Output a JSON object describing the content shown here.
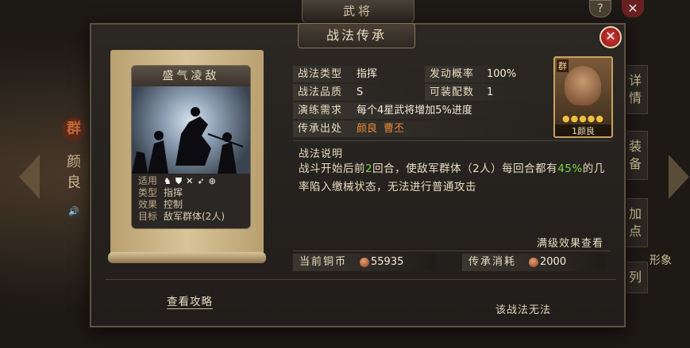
{
  "background": {
    "page_title": "武将",
    "help_icon": "?",
    "faction_badge": "群",
    "hero_name": "颜良",
    "side_tabs": [
      "详情",
      "装备",
      "加点",
      "列"
    ],
    "side_extra": "形象"
  },
  "dialog": {
    "title": "战法传承",
    "close_icon": "close-icon"
  },
  "card": {
    "name": "盛气凌敌",
    "rows": [
      {
        "key": "适用",
        "value": ""
      },
      {
        "key": "类型",
        "value": "指挥"
      },
      {
        "key": "效果",
        "value": "控制"
      },
      {
        "key": "目标",
        "value": "敌军群体(2人)"
      }
    ],
    "troop_icons": [
      "cavalry-icon",
      "shield-icon",
      "archer-icon",
      "spear-icon",
      "siege-icon"
    ]
  },
  "info": {
    "type_label": "战法类型",
    "type_value": "指挥",
    "rate_label": "发动概率",
    "rate_value": "100%",
    "quality_label": "战法品质",
    "quality_value": "S",
    "slots_label": "可装配数",
    "slots_value": "1",
    "req_label": "演练需求",
    "req_value": "每个4星武将增加5%进度",
    "source_label": "传承出处",
    "source_1": "颜良",
    "source_2": "曹丕"
  },
  "portrait": {
    "faction": "群",
    "stars": "●●●●●",
    "name": "1颜良"
  },
  "description": {
    "title": "战法说明",
    "part1": "战斗开始后前",
    "num1": "2",
    "part2": "回合，使敌军群体（2人）每回合都有",
    "num2": "45%",
    "part3": "的几率陷入缴械状态，无法进行普通攻击"
  },
  "full_effect_link": "满级效果查看",
  "costs": {
    "copper_label": "当前铜币",
    "copper_value": "55935",
    "inherit_label": "传承消耗",
    "inherit_value": "2000"
  },
  "guide_link": "查看攻略",
  "bottom_text": "该战法无法",
  "colors": {
    "accent_orange": "#e88a3a",
    "highlight_green": "#7ad84a",
    "close_red": "#d23a3a"
  }
}
